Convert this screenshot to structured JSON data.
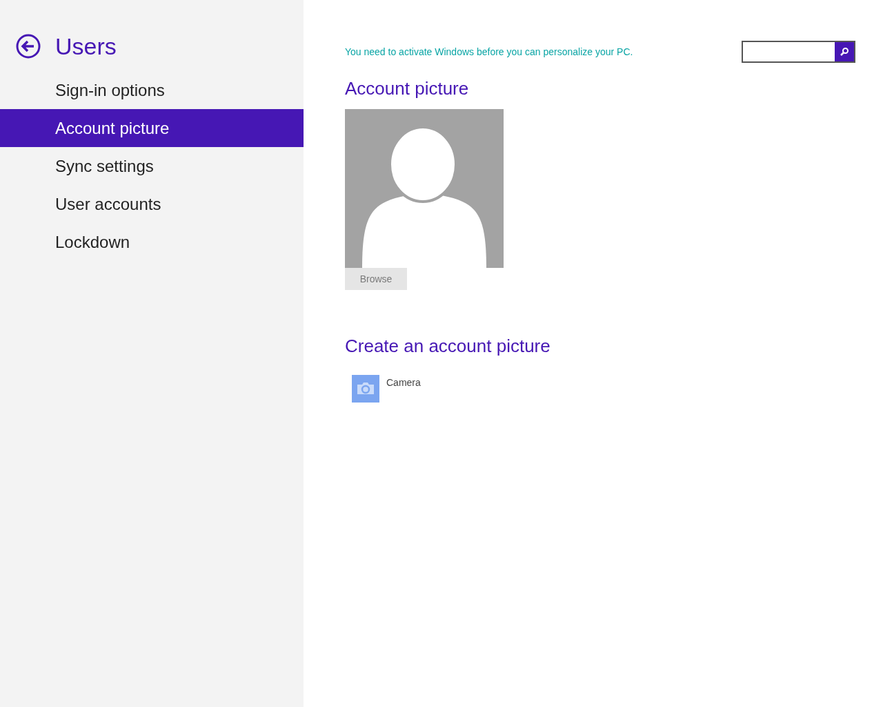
{
  "header": {
    "title": "Users"
  },
  "nav": [
    {
      "label": "Sign-in options",
      "selected": false
    },
    {
      "label": "Account picture",
      "selected": true
    },
    {
      "label": "Sync settings",
      "selected": false
    },
    {
      "label": "User accounts",
      "selected": false
    },
    {
      "label": "Lockdown",
      "selected": false
    }
  ],
  "notice": "You need to activate Windows before you can personalize your PC.",
  "account_picture": {
    "heading": "Account picture",
    "browse_button": {
      "label": "Browse",
      "disabled": true
    }
  },
  "create": {
    "heading": "Create an account picture",
    "apps": [
      {
        "label": "Camera"
      }
    ]
  }
}
